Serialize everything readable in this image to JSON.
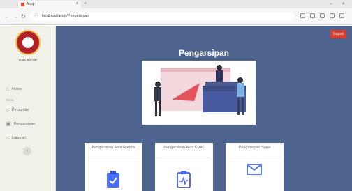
{
  "browser": {
    "tab_title": "Arsip",
    "tab_close": "×",
    "new_tab": "+",
    "url": "localhost/arsip/Pengarsipan",
    "win_minimize": "–",
    "win_close": "×"
  },
  "sidebar": {
    "logo_caption": "Kota ARSIP",
    "section_label": "Menu",
    "items": [
      {
        "label": "Home",
        "icon": "home-icon"
      },
      {
        "label": "Pencarian",
        "icon": "search-icon"
      },
      {
        "label": "Pengarsipan",
        "icon": "archive-icon"
      },
      {
        "label": "Laporan",
        "icon": "report-icon"
      }
    ],
    "toggle": "‹"
  },
  "header": {
    "signout_label": "Logout",
    "page_title": "Pengarsipan"
  },
  "cards": [
    {
      "label": "Pengarsipan Akta Notaris",
      "icon": "clipboard-check-icon"
    },
    {
      "label": "Pengarsipan Akta PPAT",
      "icon": "clipboard-pulse-icon"
    },
    {
      "label": "Pengarsipan Surat",
      "icon": "envelope-icon"
    }
  ],
  "colors": {
    "main_bg": "#4f638f",
    "sidebar_bg": "#f1f0e9",
    "accent_blue": "#4a6cf7",
    "signout_red": "#d93c2f"
  }
}
